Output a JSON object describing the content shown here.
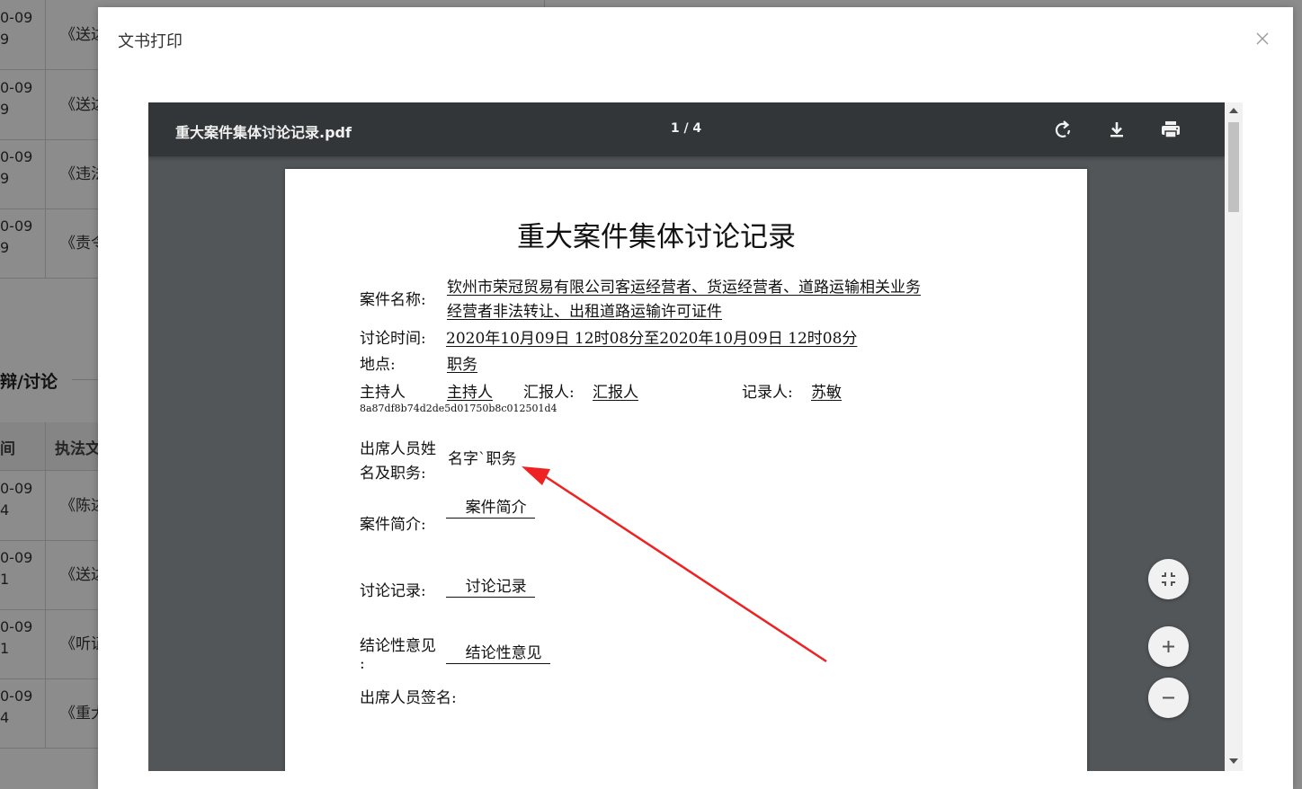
{
  "background": {
    "rows_top": [
      {
        "date": "0-09\n9",
        "doc": "《送达"
      },
      {
        "date": "0-09\n9",
        "doc": "《送达"
      },
      {
        "date": "0-09\n9",
        "doc": "《违法"
      },
      {
        "date": "0-09\n9",
        "doc": "《责令"
      }
    ],
    "section_title": "辩/讨论",
    "table_header": {
      "col_a": "间",
      "col_b": "执法文"
    },
    "rows_bottom": [
      {
        "date": "0-09\n4",
        "doc": "《陈述"
      },
      {
        "date": "0-09\n1",
        "doc": "《送达"
      },
      {
        "date": "0-09\n1",
        "doc": "《听证"
      },
      {
        "date": "0-09\n4",
        "doc": "《重大"
      }
    ]
  },
  "modal": {
    "title": "文书打印",
    "close_icon": "close-icon"
  },
  "viewer": {
    "file_name": "重大案件集体讨论记录.pdf",
    "page_indicator": "1 / 4",
    "toolbar_icons": [
      "rotate-icon",
      "download-icon",
      "print-icon"
    ],
    "zoom_icons": [
      "fit-page-icon",
      "zoom-in-icon",
      "zoom-out-icon"
    ]
  },
  "document": {
    "title": "重大案件集体讨论记录",
    "case_name_label": "案件名称:",
    "case_name_line1": "钦州市荣冠贸易有限公司客运经营者、货运经营者、道路运输相关业务",
    "case_name_line2": "经营者非法转让、出租道路运输许可证件",
    "time_label": "讨论时间:",
    "time_value": "2020年10月09日 12时08分至2020年10月09日 12时08分",
    "place_label": "地点:",
    "place_value": "职务",
    "host_label": "主持人",
    "host_value": "主持人",
    "reporter_label": "汇报人:",
    "reporter_value": "汇报人",
    "recorder_label": "记录人:",
    "recorder_value": "苏敏",
    "doc_id": "8a87df8b74d2de5d01750b8c012501d4",
    "attendees_label_line1": "出席人员姓",
    "attendees_label_line2": "名及职务:",
    "attendees_value": "名字`职务",
    "summary_label": "案件简介:",
    "summary_value": "    案件简介",
    "discussion_label": "讨论记录:",
    "discussion_value": "    讨论记录",
    "conclusion_label_line1": "结论性意见",
    "conclusion_label_line2": ":",
    "conclusion_value": "    结论性意见",
    "signature_label": "出席人员签名:"
  },
  "annotation": {
    "color": "#ee2222"
  }
}
